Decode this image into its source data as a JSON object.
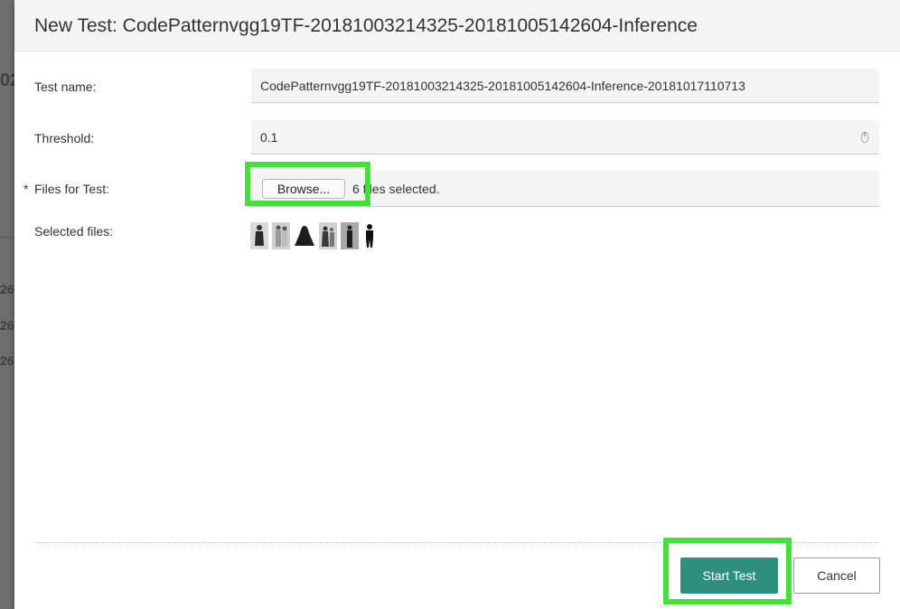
{
  "background": {
    "partial_text": [
      "02",
      "26",
      "26",
      "26"
    ]
  },
  "dialog": {
    "title": "New Test: CodePatternvgg19TF-20181003214325-20181005142604-Inference",
    "fields": {
      "test_name": {
        "label": "Test name:",
        "value": "CodePatternvgg19TF-20181003214325-20181005142604-Inference-20181017110713"
      },
      "threshold": {
        "label": "Threshold:",
        "value": "0.1"
      },
      "files": {
        "required_mark": "*",
        "label": "Files for Test:",
        "browse_label": "Browse...",
        "status": "6 files selected."
      },
      "selected_files": {
        "label": "Selected files:",
        "thumbnail_count": 6
      }
    },
    "footer": {
      "start_label": "Start Test",
      "cancel_label": "Cancel"
    }
  },
  "colors": {
    "primary_button": "#2f8f7f",
    "highlight_box": "#44e03a",
    "header_bg": "#f4f4f4"
  }
}
